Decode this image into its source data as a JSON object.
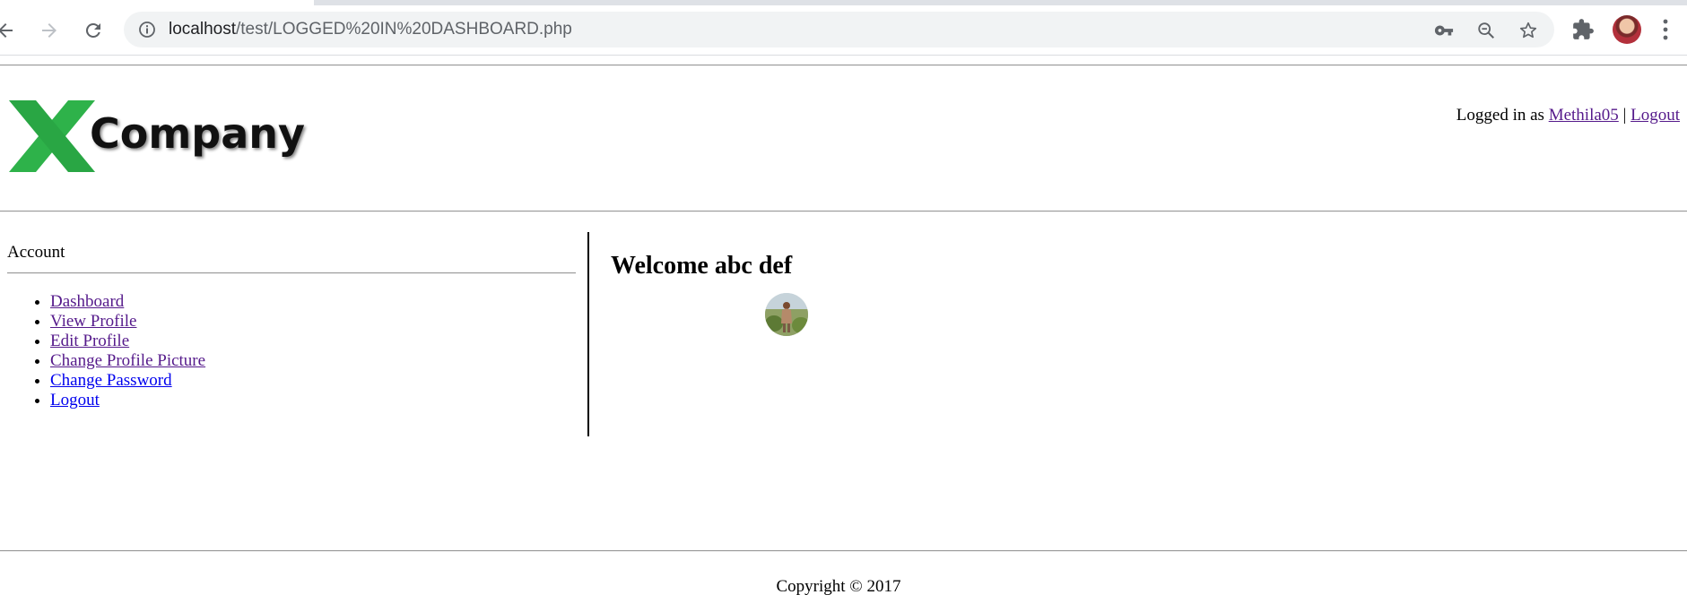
{
  "browser": {
    "url_host": "localhost",
    "url_path": "/test/LOGGED%20IN%20DASHBOARD.php",
    "icons": {
      "back": "back-arrow-icon",
      "forward": "forward-arrow-icon",
      "reload": "reload-icon",
      "info": "info-icon",
      "key": "key-icon",
      "zoom": "zoom-out-icon",
      "bookmark": "star-icon",
      "extensions": "puzzle-icon",
      "menu": "kebab-menu-icon"
    }
  },
  "header": {
    "logo_text": "Company",
    "logged_in_prefix": "Logged in as",
    "username": "Methila05",
    "separator": "|",
    "logout_label": "Logout"
  },
  "sidebar": {
    "title": "Account",
    "items": [
      {
        "label": "Dashboard"
      },
      {
        "label": "View Profile"
      },
      {
        "label": "Edit Profile"
      },
      {
        "label": "Change Profile Picture"
      },
      {
        "label": "Change Password"
      },
      {
        "label": "Logout"
      }
    ]
  },
  "main": {
    "welcome": "Welcome abc def"
  },
  "footer": {
    "copyright": "Copyright © 2017"
  },
  "colors": {
    "visited_link": "#551a8b",
    "unvisited_link": "#0000ee",
    "logo_green": "#2eb24a"
  }
}
